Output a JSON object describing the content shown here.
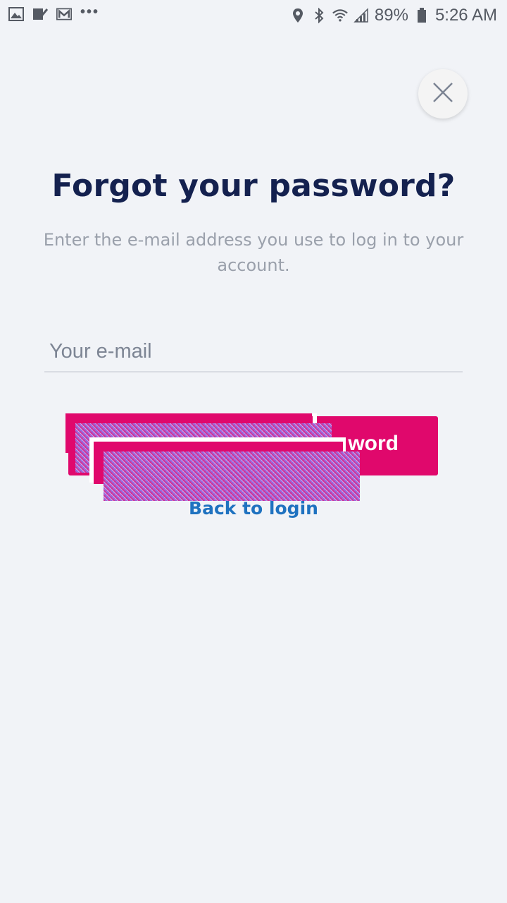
{
  "status_bar": {
    "battery": "89%",
    "time": "5:26 AM",
    "left_icons": [
      "image-icon",
      "check-icon",
      "mail-icon",
      "more-icon"
    ],
    "right_icons": [
      "location-icon",
      "bluetooth-icon",
      "wifi-icon",
      "signal-icon",
      "battery-icon"
    ]
  },
  "page": {
    "title": "Forgot your password?",
    "subtitle": "Enter the e-mail address you use to log in to your account.",
    "email_placeholder": "Your e-mail",
    "submit_label": "word",
    "back_link": "Back to login"
  },
  "colors": {
    "background": "#f1f3f7",
    "title": "#14214f",
    "accent": "#e0086c",
    "link": "#1f72c0"
  }
}
